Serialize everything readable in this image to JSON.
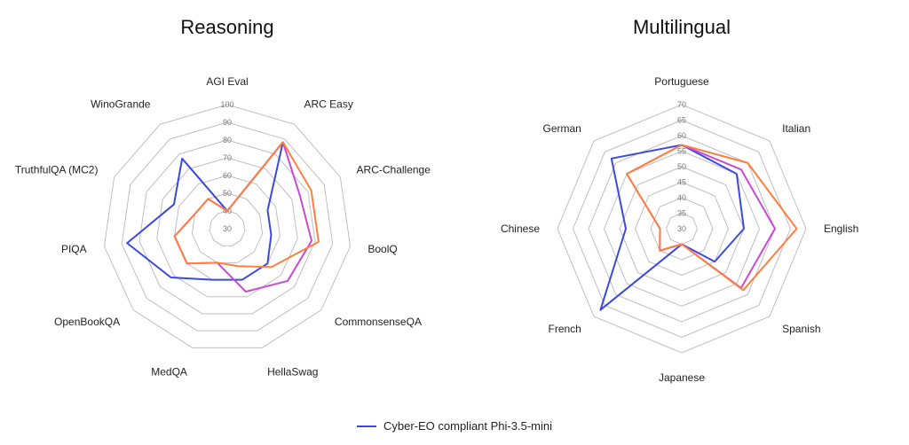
{
  "legend": {
    "label": "Cyber-EO compliant Phi-3.5-mini",
    "color": "#3b49e0"
  },
  "colors": {
    "grid": "#bfbfbf",
    "tick_text": "#7a7a7a",
    "label_text": "#222222",
    "series_blue": "#3b49e0",
    "series_magenta": "#c84bd6",
    "series_orange": "#ff7f3f"
  },
  "chart_data": [
    {
      "type": "radar",
      "title": "Reasoning",
      "categories": [
        "AGI Eval",
        "ARC Easy",
        "ARC-Challenge",
        "BoolQ",
        "CommonsenseQA",
        "HellaSwag",
        "MedQA",
        "OpenBookQA",
        "PIQA",
        "TruthfulQA (MC2)",
        "WinoGrande"
      ],
      "ticks": [
        30,
        40,
        50,
        60,
        70,
        80,
        90,
        100
      ],
      "range": [
        30,
        100
      ],
      "series": [
        {
          "name": "blue",
          "color_key": "series_blue",
          "values": [
            40,
            88,
            55,
            55,
            60,
            60,
            60,
            72,
            87,
            63,
            77
          ]
        },
        {
          "name": "magenta",
          "color_key": "series_magenta",
          "values": [
            40,
            88,
            75,
            78,
            75,
            67,
            50,
            60,
            60,
            50,
            50
          ]
        },
        {
          "name": "orange",
          "color_key": "series_orange",
          "values": [
            40,
            88,
            82,
            82,
            63,
            52,
            50,
            60,
            60,
            50,
            50
          ]
        }
      ]
    },
    {
      "type": "radar",
      "title": "Multilingual",
      "categories": [
        "Portuguese",
        "Italian",
        "English",
        "Spanish",
        "Japanese",
        "French",
        "Chinese",
        "German"
      ],
      "ticks": [
        30,
        35,
        40,
        45,
        50,
        55,
        60,
        65,
        70
      ],
      "range": [
        30,
        70
      ],
      "series": [
        {
          "name": "blue",
          "color_key": "series_blue",
          "values": [
            57,
            55,
            50,
            45,
            35,
            67,
            48,
            62
          ]
        },
        {
          "name": "magenta",
          "color_key": "series_magenta",
          "values": [
            57,
            57,
            60,
            57,
            35,
            40,
            37,
            55
          ]
        },
        {
          "name": "orange",
          "color_key": "series_orange",
          "values": [
            57,
            60,
            67,
            58,
            35,
            40,
            37,
            55
          ]
        }
      ]
    }
  ]
}
